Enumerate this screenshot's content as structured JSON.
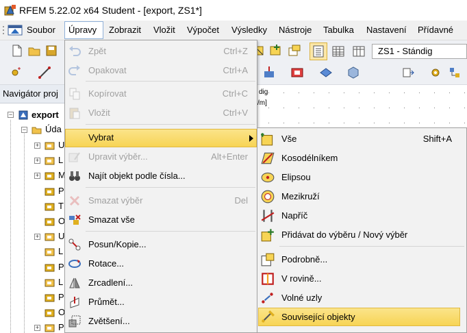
{
  "window": {
    "title": "RFEM 5.22.02 x64 Student - [export, ZS1*]"
  },
  "menubar": {
    "items": [
      "Soubor",
      "Úpravy",
      "Zobrazit",
      "Vložit",
      "Výpočet",
      "Výsledky",
      "Nástroje",
      "Tabulka",
      "Nastavení",
      "Přídavné mo"
    ],
    "active": "Úpravy"
  },
  "toolbar": {
    "load_case": "ZS1 - Stándig"
  },
  "navigator": {
    "title": "Navigátor proj",
    "root": "export",
    "data_node": "Úda",
    "children": [
      "U",
      "L",
      "M",
      "P",
      "T",
      "O",
      "U",
      "L",
      "P",
      "L",
      "P",
      "O",
      "P"
    ]
  },
  "graphic": {
    "label1": "dig",
    "label2": "/m]"
  },
  "edit_menu": {
    "items": [
      {
        "label": "Zpět",
        "shortcut": "Ctrl+Z",
        "enabled": false,
        "icon": "undo-icon"
      },
      {
        "label": "Opakovat",
        "shortcut": "Ctrl+A",
        "enabled": false,
        "icon": "redo-icon"
      },
      {
        "label": "Kopírovat",
        "shortcut": "Ctrl+C",
        "enabled": false,
        "icon": "copy-icon"
      },
      {
        "label": "Vložit",
        "shortcut": "Ctrl+V",
        "enabled": false,
        "icon": "paste-icon"
      },
      {
        "label": "Vybrat",
        "shortcut": "",
        "enabled": true,
        "icon": "",
        "submenu": true
      },
      {
        "label": "Upravit výběr...",
        "shortcut": "Alt+Enter",
        "enabled": false,
        "icon": "edit-selection-icon"
      },
      {
        "label": "Najít objekt podle čísla...",
        "shortcut": "",
        "enabled": true,
        "icon": "binoculars-icon"
      },
      {
        "label": "Smazat výběr",
        "shortcut": "Del",
        "enabled": false,
        "icon": "delete-selection-icon"
      },
      {
        "label": "Smazat vše",
        "shortcut": "",
        "enabled": true,
        "icon": "delete-all-icon"
      },
      {
        "label": "Posun/Kopie...",
        "shortcut": "",
        "enabled": true,
        "icon": "move-copy-icon"
      },
      {
        "label": "Rotace...",
        "shortcut": "",
        "enabled": true,
        "icon": "rotate-icon"
      },
      {
        "label": "Zrcadlení...",
        "shortcut": "",
        "enabled": true,
        "icon": "mirror-icon"
      },
      {
        "label": "Průmět...",
        "shortcut": "",
        "enabled": true,
        "icon": "project-icon"
      },
      {
        "label": "Zvětšení...",
        "shortcut": "",
        "enabled": true,
        "icon": "scale-icon"
      }
    ]
  },
  "select_submenu": {
    "items": [
      {
        "label": "Vše",
        "shortcut": "Shift+A",
        "icon": "select-all-icon"
      },
      {
        "label": "Kosodélníkem",
        "shortcut": "",
        "icon": "rhomboid-select-icon"
      },
      {
        "label": "Elipsou",
        "shortcut": "",
        "icon": "ellipse-select-icon"
      },
      {
        "label": "Mezikruží",
        "shortcut": "",
        "icon": "ring-select-icon"
      },
      {
        "label": "Napříč",
        "shortcut": "",
        "icon": "cross-select-icon"
      },
      {
        "label": "Přidávat do výběru / Nový výběr",
        "shortcut": "",
        "icon": "add-to-selection-icon"
      },
      {
        "label": "Podrobně...",
        "shortcut": "",
        "icon": "detailed-select-icon"
      },
      {
        "label": "V rovině...",
        "shortcut": "",
        "icon": "in-plane-icon"
      },
      {
        "label": "Volné uzly",
        "shortcut": "",
        "icon": "free-nodes-icon"
      },
      {
        "label": "Související objekty",
        "shortcut": "",
        "icon": "related-objects-icon"
      }
    ],
    "highlighted": "Související objekty"
  },
  "colors": {
    "highlight": "#f7d455",
    "menu_bg": "#f2f2f2",
    "disabled": "#a0a0a0"
  }
}
